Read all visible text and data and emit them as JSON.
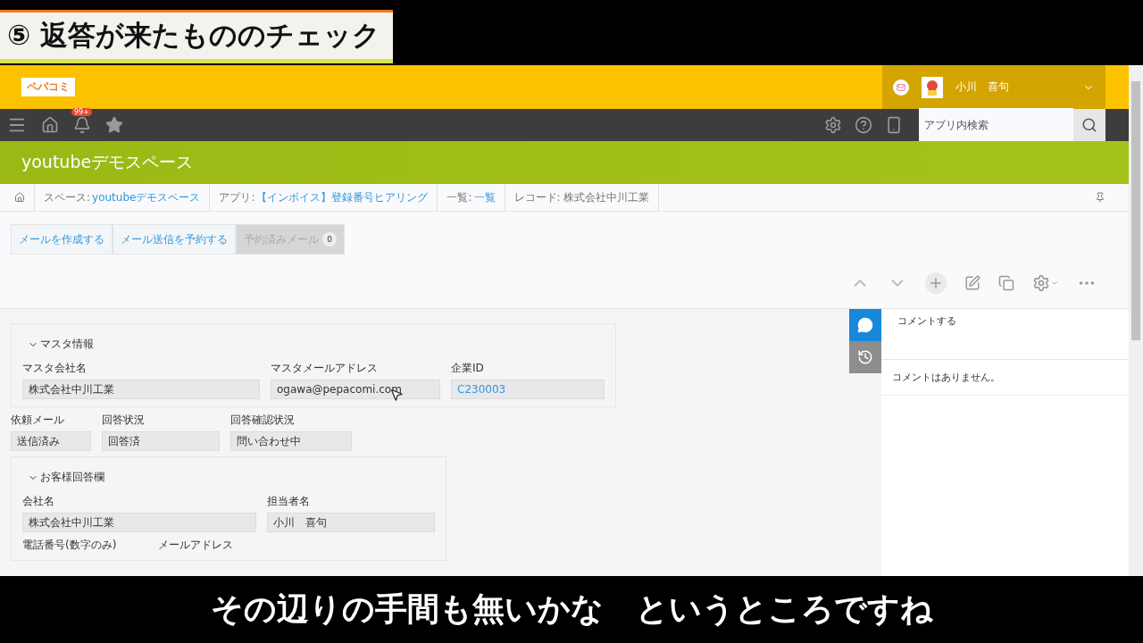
{
  "caption": {
    "title": "⑤ 返答が来たもののチェック"
  },
  "header": {
    "logo": "ペパコミ",
    "user_name": "小川　喜句"
  },
  "nav": {
    "notification_badge": "99+",
    "search": {
      "placeholder": "アプリ内検索"
    }
  },
  "space_banner": {
    "title": "youtubeデモスペース"
  },
  "breadcrumb": [
    {
      "prefix": "スペース: ",
      "link": "youtubeデモスペース"
    },
    {
      "prefix": "アプリ: ",
      "link": "【インボイス】登録番号ヒアリング"
    },
    {
      "prefix": "一覧: ",
      "link": "一覧"
    },
    {
      "prefix": "レコード: 株式会社中川工業"
    }
  ],
  "mail_buttons": [
    {
      "label": "メールを作成する",
      "disabled": false
    },
    {
      "label": "メール送信を予約する",
      "disabled": false
    },
    {
      "label": "予約済みメール",
      "disabled": true,
      "count": "0"
    }
  ],
  "form": [
    {
      "kind": "group",
      "title": "マスタ情報",
      "expanded": true,
      "rows": [
        [
          {
            "label": "マスタ会社名",
            "value": "株式会社中川工業",
            "link": false
          },
          {
            "label": "マスタメールアドレス",
            "value": "ogawa@pepacomi.com",
            "link": false
          },
          {
            "label": "企業ID",
            "value": "C230003",
            "link": true
          }
        ]
      ]
    },
    {
      "kind": "row",
      "fields": [
        {
          "label": "依頼メール",
          "value": "送信済み",
          "link": false
        },
        {
          "label": "回答状況",
          "value": "回答済",
          "link": false
        },
        {
          "label": "回答確認状況",
          "value": "問い合わせ中",
          "link": false
        }
      ]
    },
    {
      "kind": "group",
      "title": "お客様回答欄",
      "expanded": true,
      "rows": [
        [
          {
            "label": "会社名",
            "value": "株式会社中川工業",
            "link": false
          },
          {
            "label": "担当者名",
            "value": "小川　喜句",
            "link": false
          }
        ],
        [
          {
            "label": "電話番号(数字のみ)"
          },
          {
            "label": "メールアドレス"
          }
        ]
      ]
    }
  ],
  "comments": {
    "tabs": [
      {
        "kind": "comment",
        "selected": true
      },
      {
        "kind": "history",
        "selected": false
      }
    ],
    "input": {
      "placeholder": "コメントする"
    },
    "empty": "コメントはありません。"
  },
  "subtitle": "その辺りの手間も無いかな　というところですね"
}
